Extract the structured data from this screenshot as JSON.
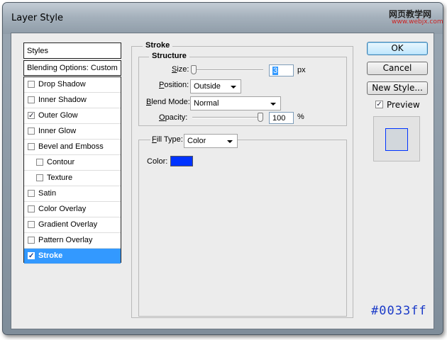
{
  "window": {
    "title": "Layer Style",
    "watermark_top": "网页教学网",
    "watermark_bottom": "www.webjx.com"
  },
  "styles_panel": {
    "header": "Styles",
    "blending_options": "Blending Options: Custom",
    "items": [
      {
        "label": "Drop Shadow",
        "checked": false,
        "sub": false,
        "active": false
      },
      {
        "label": "Inner Shadow",
        "checked": false,
        "sub": false,
        "active": false
      },
      {
        "label": "Outer Glow",
        "checked": true,
        "sub": false,
        "active": false
      },
      {
        "label": "Inner Glow",
        "checked": false,
        "sub": false,
        "active": false
      },
      {
        "label": "Bevel and Emboss",
        "checked": false,
        "sub": false,
        "active": false
      },
      {
        "label": "Contour",
        "checked": false,
        "sub": true,
        "active": false
      },
      {
        "label": "Texture",
        "checked": false,
        "sub": true,
        "active": false
      },
      {
        "label": "Satin",
        "checked": false,
        "sub": false,
        "active": false
      },
      {
        "label": "Color Overlay",
        "checked": false,
        "sub": false,
        "active": false
      },
      {
        "label": "Gradient Overlay",
        "checked": false,
        "sub": false,
        "active": false
      },
      {
        "label": "Pattern Overlay",
        "checked": false,
        "sub": false,
        "active": false
      },
      {
        "label": "Stroke",
        "checked": true,
        "sub": false,
        "active": true
      }
    ]
  },
  "stroke": {
    "title": "Stroke",
    "structure_title": "Structure",
    "size_label": "Size:",
    "size_value": "3",
    "size_unit": "px",
    "position_label": "Position:",
    "position_value": "Outside",
    "blend_mode_label": "Blend Mode:",
    "blend_mode_value": "Normal",
    "opacity_label": "Opacity:",
    "opacity_value": "100",
    "opacity_unit": "%",
    "opacity_level": 1.0,
    "size_level": 0.0
  },
  "fill": {
    "fill_type_label": "Fill Type:",
    "fill_type_value": "Color",
    "color_label": "Color:",
    "color_hex": "#0033ff"
  },
  "buttons": {
    "ok": "OK",
    "cancel": "Cancel",
    "new_style": "New Style..."
  },
  "preview": {
    "label": "Preview",
    "checked": true
  },
  "hex_caption": "#0033ff",
  "colors": {
    "accent": "#3399ff",
    "stroke_color": "#0033ff"
  }
}
